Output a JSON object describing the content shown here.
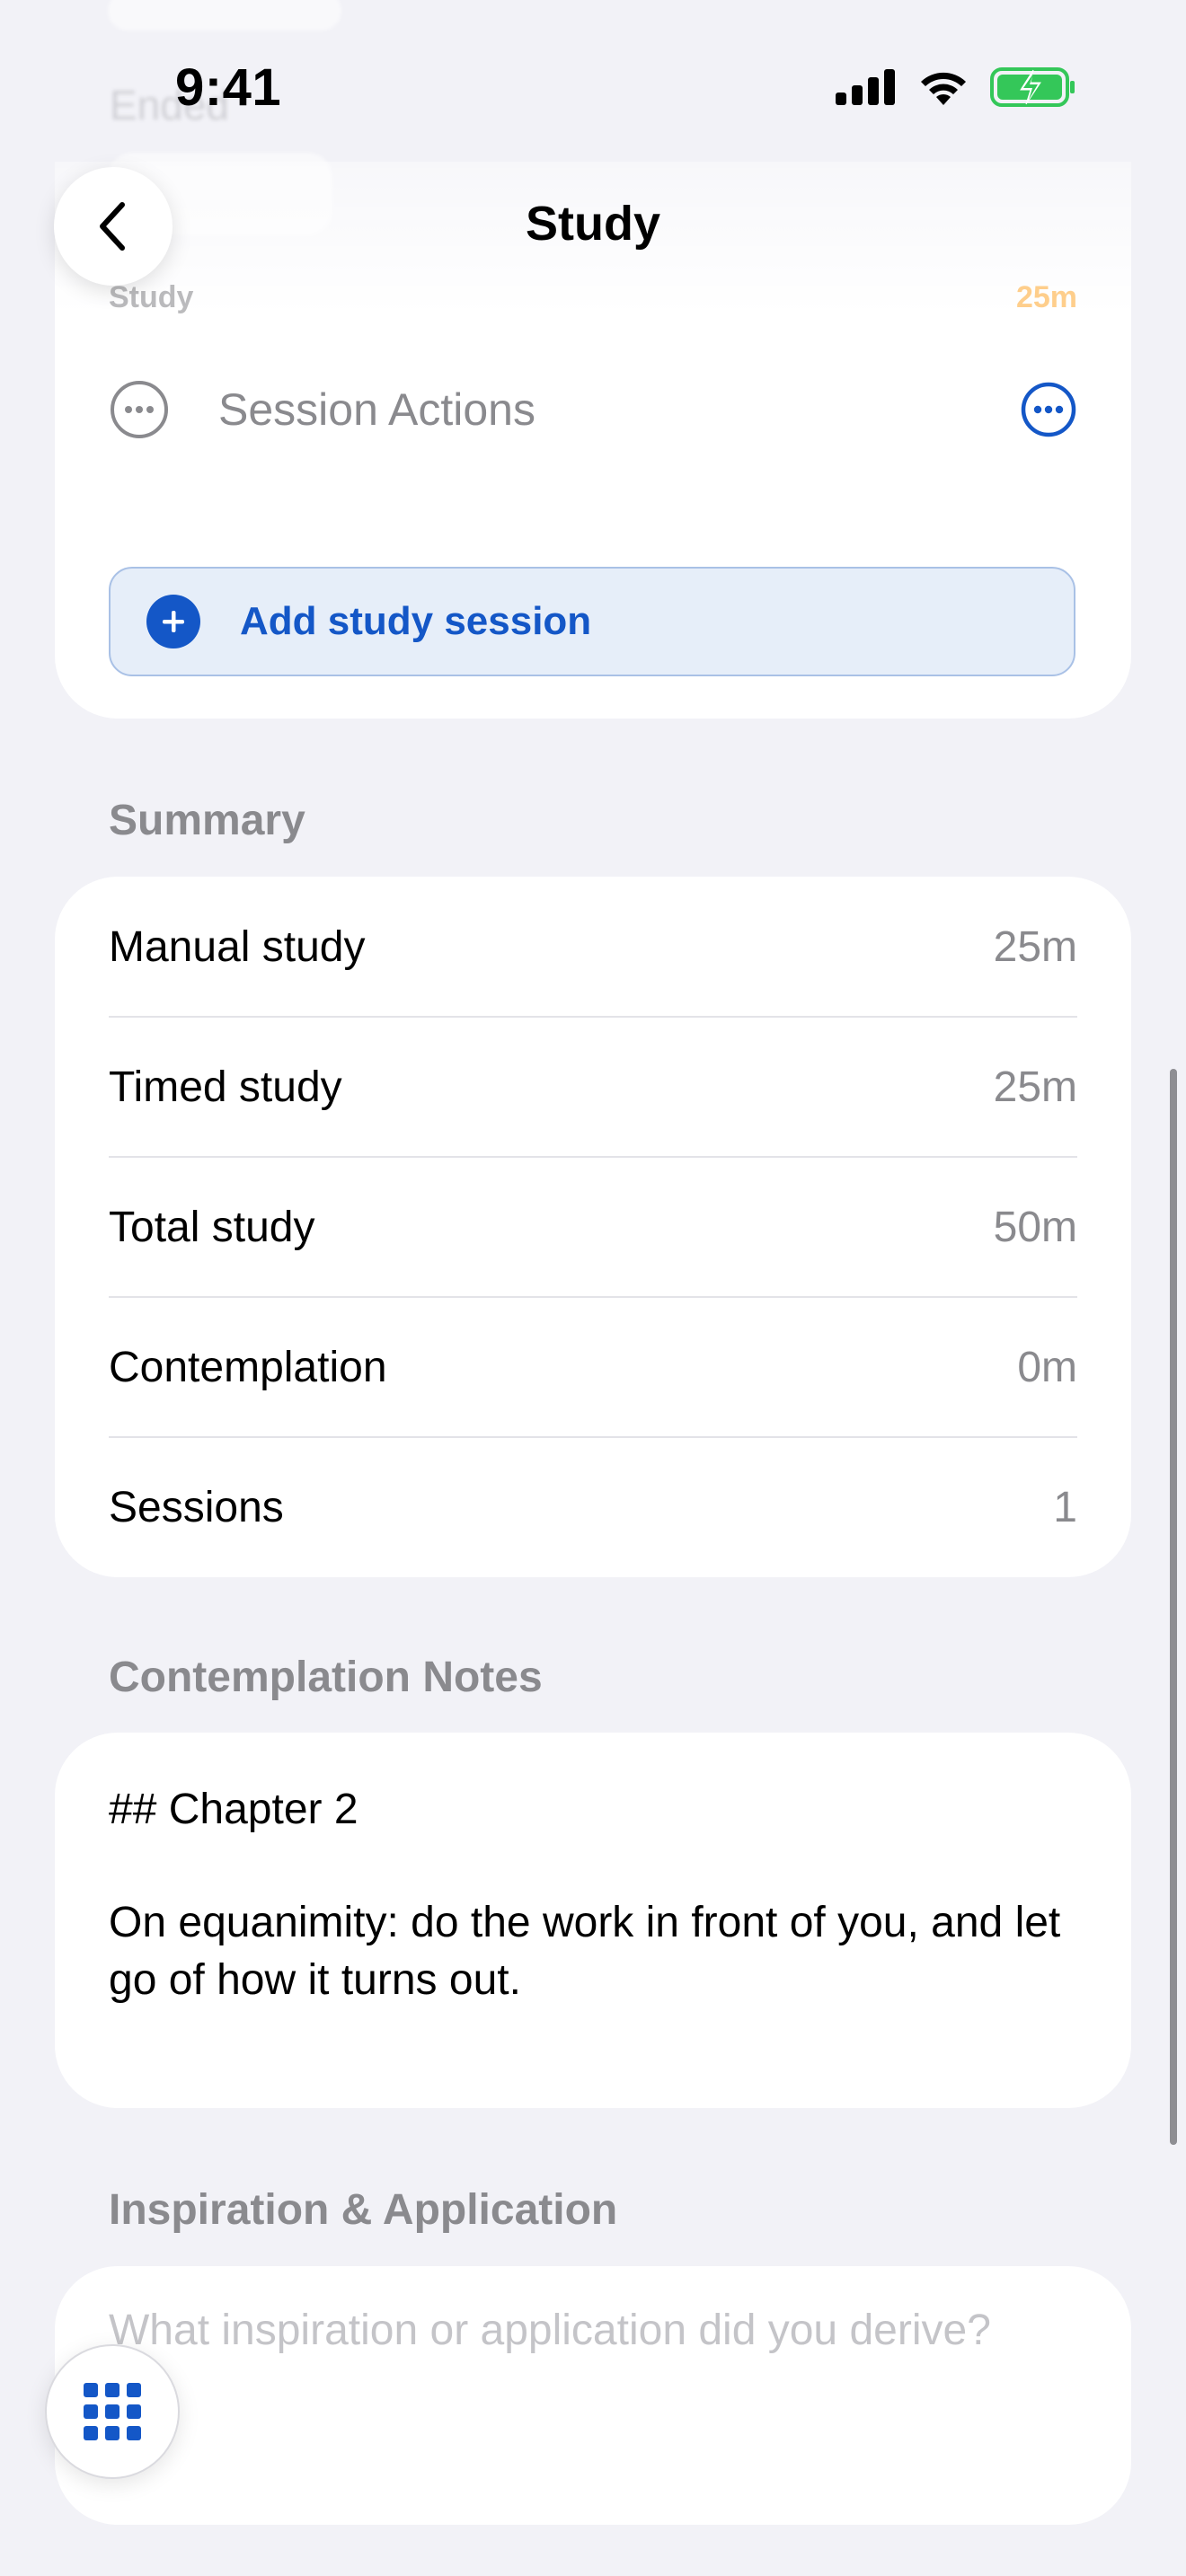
{
  "status": {
    "time": "9:41"
  },
  "nav": {
    "title": "Study"
  },
  "top_card": {
    "faded_label": "Study",
    "faded_value": "25m",
    "session_actions_label": "Session Actions",
    "add_button_label": "Add study session"
  },
  "summary": {
    "header": "Summary",
    "rows": [
      {
        "label": "Manual study",
        "value": "25m"
      },
      {
        "label": "Timed study",
        "value": "25m"
      },
      {
        "label": "Total study",
        "value": "50m"
      },
      {
        "label": "Contemplation",
        "value": "0m"
      },
      {
        "label": "Sessions",
        "value": "1"
      }
    ]
  },
  "contemplation_notes": {
    "header": "Contemplation Notes",
    "title": "## Chapter 2",
    "body": "On equanimity: do the work in front of you, and let go of how it turns out."
  },
  "inspiration": {
    "header": "Inspiration & Application",
    "placeholder": "What inspiration or application did you derive?"
  },
  "colors": {
    "accent": "#1457C7",
    "background": "#F2F2F7",
    "secondary_text": "#8A8A8E",
    "battery_green": "#34C759"
  },
  "icons": {
    "back": "chevron-left-icon",
    "more": "ellipsis-circle-icon",
    "add": "plus-circle-icon",
    "grid": "grid-icon"
  }
}
